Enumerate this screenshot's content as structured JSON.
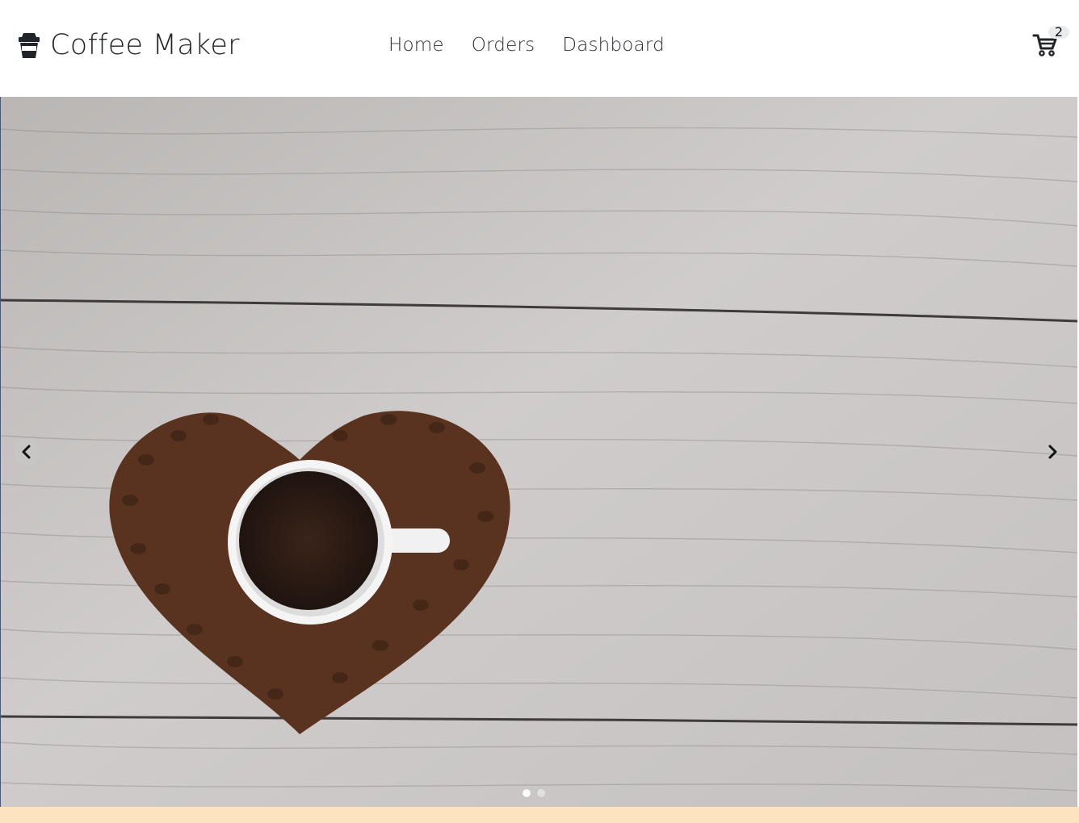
{
  "brand": {
    "name": "Coffee Maker",
    "icon": "coffee-cup-icon"
  },
  "nav": {
    "items": [
      {
        "label": "Home"
      },
      {
        "label": "Orders"
      },
      {
        "label": "Dashboard"
      }
    ]
  },
  "cart": {
    "icon": "shopping-cart-icon",
    "count": "2"
  },
  "hero": {
    "image": "coffee-cup-on-heart-of-beans-photo",
    "prev_icon": "chevron-left-icon",
    "next_icon": "chevron-right-icon",
    "slides": 2,
    "active_slide": 1
  },
  "colors": {
    "text": "#212529",
    "footer_strip": "#fde3bf",
    "wood_light": "#c9c7c6",
    "wood_dark": "#8e8b8a",
    "coffee": "#2a1a14",
    "beans": "#5a3320"
  }
}
